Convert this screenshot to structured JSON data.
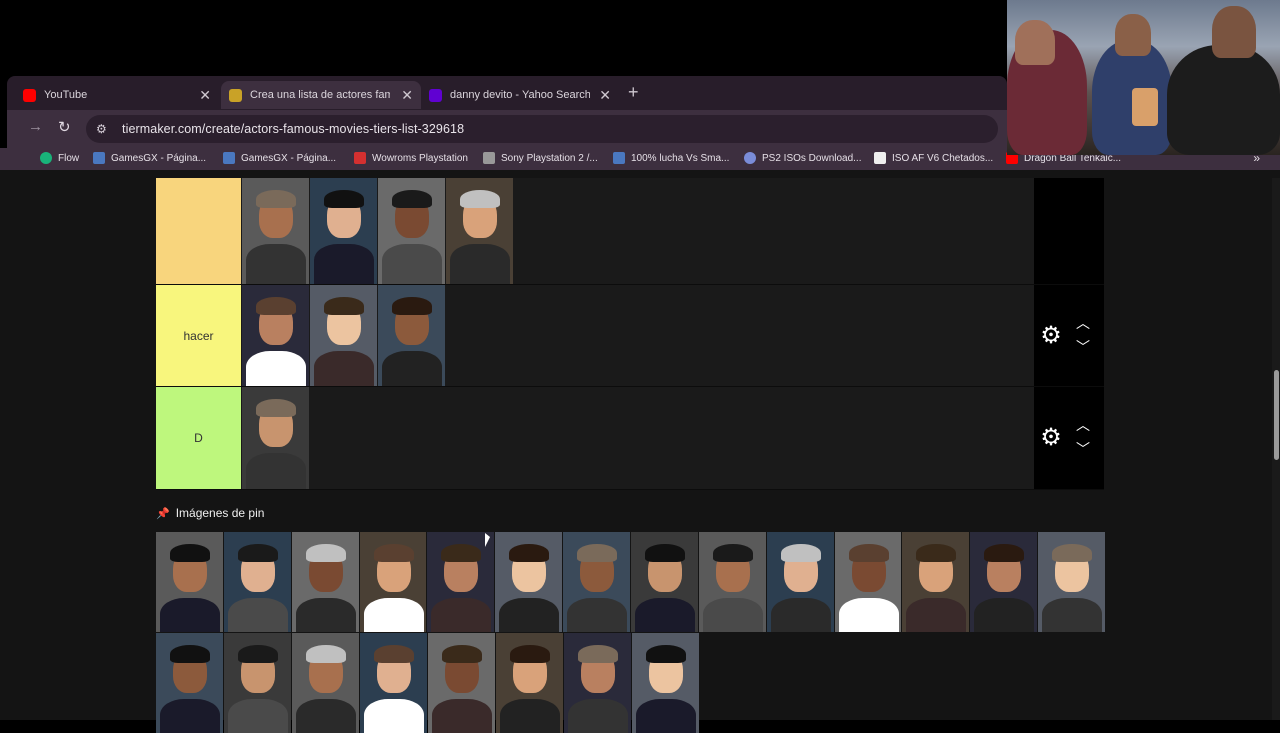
{
  "tabs": [
    {
      "title": "YouTube",
      "color": "#ff0000"
    },
    {
      "title": "Crea una lista de actores famos",
      "color": "#c9a227",
      "active": true
    },
    {
      "title": "danny devito - Yahoo Search Tu",
      "color": "#6001d2"
    }
  ],
  "url": "tiermaker.com/create/actors-famous-movies-tiers-list-329618",
  "bookmarks": [
    {
      "label": "Flow",
      "color": "#19b37a"
    },
    {
      "label": "GamesGX - Página...",
      "color": "#4a78c0"
    },
    {
      "label": "GamesGX - Página...",
      "color": "#4a78c0"
    },
    {
      "label": "Wowroms Playstation",
      "color": "#d43030"
    },
    {
      "label": "Sony Playstation 2 /...",
      "color": "#999999"
    },
    {
      "label": "100% lucha Vs Sma...",
      "color": "#4a78c0"
    },
    {
      "label": "PS2 ISOs Download...",
      "color": "#7a8cd8"
    },
    {
      "label": "ISO AF V6 Chetados...",
      "color": "#eeeeee"
    },
    {
      "label": "Dragon Ball Tenkaic...",
      "color": "#ff0000"
    }
  ],
  "tiers": [
    {
      "label": "",
      "color": "#f8d57d",
      "count": 4
    },
    {
      "label": "hacer",
      "color": "#f8f67d",
      "count": 3
    },
    {
      "label": "D",
      "color": "#bef77d",
      "count": 1
    }
  ],
  "pool_title": "Imágenes de pin",
  "pool_row1_count": 14,
  "pool_row2_count": 8,
  "icons": {
    "gear": "gear-icon",
    "up": "chevron-up-icon",
    "down": "chevron-down-icon",
    "pin": "pin-icon"
  }
}
